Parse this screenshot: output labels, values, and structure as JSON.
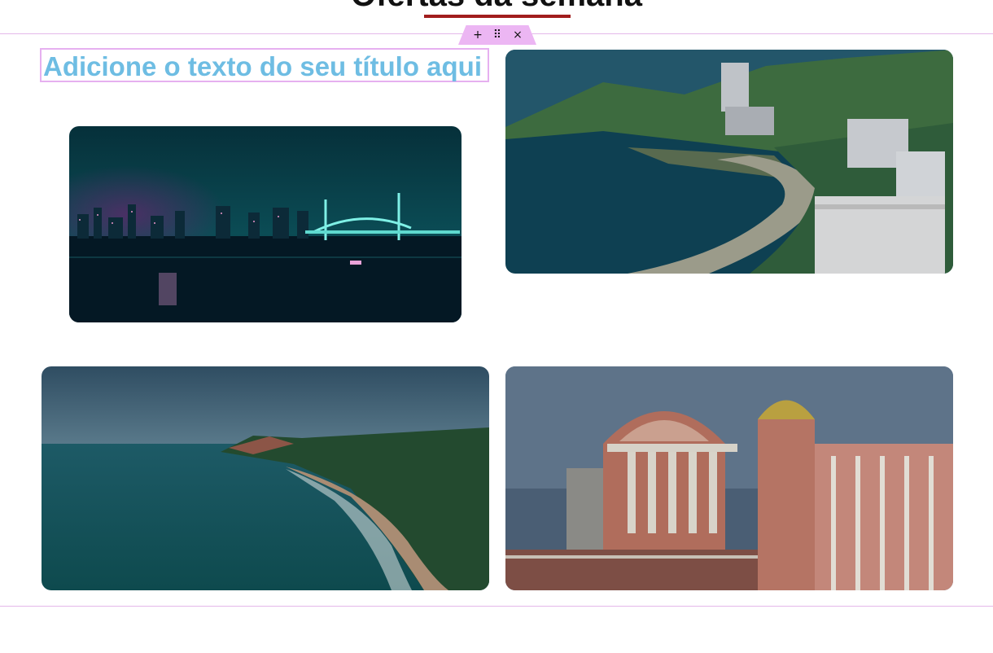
{
  "page": {
    "heading": "Ofertas da semana"
  },
  "colors": {
    "accent_underline": "#a11d1d",
    "section_border": "#e4b8ea",
    "handle_bg": "#ecb6f3",
    "title_text": "#6ebde3",
    "overlay": "#000000"
  },
  "editor": {
    "add_icon": "+",
    "drag_icon": "⠿",
    "close_icon": "×"
  },
  "widget": {
    "title": "Adicione o texto do seu título aqui"
  },
  "images": [
    {
      "icon": "night-city-bridge-image"
    },
    {
      "icon": "coastal-city-beach-image"
    },
    {
      "icon": "ocean-coast-cliffs-image"
    },
    {
      "icon": "theatre-building-image"
    }
  ]
}
